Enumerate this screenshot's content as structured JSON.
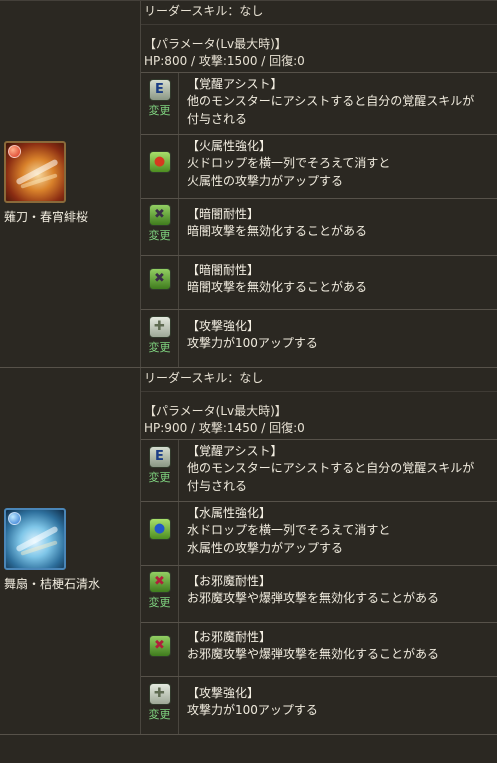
{
  "monsters": [
    {
      "name": "薙刀・春宵緋桜",
      "attribute": "fire",
      "leader_skill": "リーダースキル：なし",
      "params_title": "【パラメータ(Lv最大時)】",
      "params_values": "HP:800 / 攻撃:1500 / 回復:0",
      "skills": [
        {
          "icon": "awakening-assist-icon",
          "glyph": "E",
          "change": "変更",
          "title": "【覚醒アシスト】",
          "desc": [
            "他のモンスターにアシストすると自分の覚醒スキルが",
            "付与される"
          ]
        },
        {
          "icon": "fire-row-enhance-icon",
          "glyph": "●",
          "change": "",
          "title": "【火属性強化】",
          "desc": [
            "火ドロップを横一列でそろえて消すと",
            "火属性の攻撃力がアップする"
          ]
        },
        {
          "icon": "dark-resist-icon",
          "glyph": "✖",
          "change": "変更",
          "title": "【暗闇耐性】",
          "desc": [
            "暗闇攻撃を無効化することがある"
          ]
        },
        {
          "icon": "dark-resist-icon",
          "glyph": "✖",
          "change": "",
          "title": "【暗闇耐性】",
          "desc": [
            "暗闇攻撃を無効化することがある"
          ]
        },
        {
          "icon": "attack-enhance-icon",
          "glyph": "✚",
          "change": "変更",
          "title": "【攻撃強化】",
          "desc": [
            "攻撃力が100アップする"
          ]
        }
      ]
    },
    {
      "name": "舞扇・桔梗石清水",
      "attribute": "water",
      "leader_skill": "リーダースキル：なし",
      "params_title": "【パラメータ(Lv最大時)】",
      "params_values": "HP:900 / 攻撃:1450 / 回復:0",
      "skills": [
        {
          "icon": "awakening-assist-icon",
          "glyph": "E",
          "change": "変更",
          "title": "【覚醒アシスト】",
          "desc": [
            "他のモンスターにアシストすると自分の覚醒スキルが",
            "付与される"
          ]
        },
        {
          "icon": "water-row-enhance-icon",
          "glyph": "●",
          "change": "",
          "title": "【水属性強化】",
          "desc": [
            "水ドロップを横一列でそろえて消すと",
            "水属性の攻撃力がアップする"
          ]
        },
        {
          "icon": "jammer-resist-icon",
          "glyph": "✖",
          "change": "変更",
          "title": "【お邪魔耐性】",
          "desc": [
            "お邪魔攻撃や爆弾攻撃を無効化することがある"
          ]
        },
        {
          "icon": "jammer-resist-icon",
          "glyph": "✖",
          "change": "",
          "title": "【お邪魔耐性】",
          "desc": [
            "お邪魔攻撃や爆弾攻撃を無効化することがある"
          ]
        },
        {
          "icon": "attack-enhance-icon",
          "glyph": "✚",
          "change": "変更",
          "title": "【攻撃強化】",
          "desc": [
            "攻撃力が100アップする"
          ]
        }
      ]
    }
  ]
}
